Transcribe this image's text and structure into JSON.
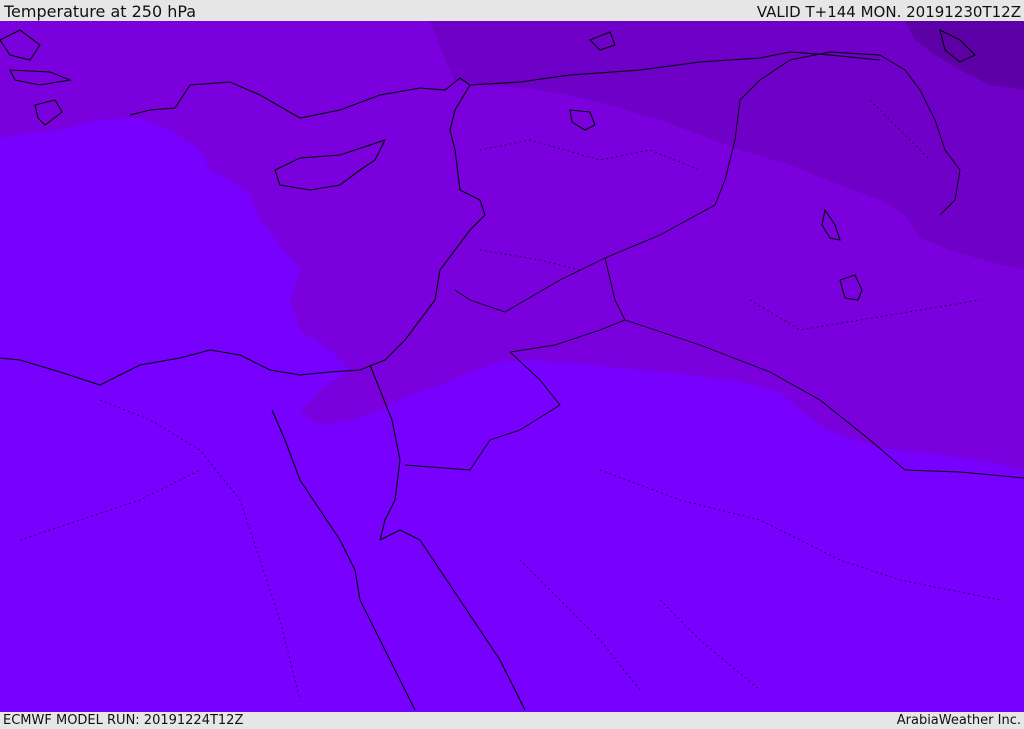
{
  "header": {
    "title": "Temperature at 250 hPa",
    "valid": "VALID T+144 MON. 20191230T12Z"
  },
  "footer": {
    "model_run": "ECMWF MODEL RUN: 20191224T12Z",
    "credit": "ArabiaWeather Inc."
  },
  "map": {
    "colors": {
      "coldest": "#5e00a8",
      "colder": "#6f00c8",
      "cold": "#7a00de",
      "base": "#7700ff",
      "coastline": "#000000"
    }
  }
}
